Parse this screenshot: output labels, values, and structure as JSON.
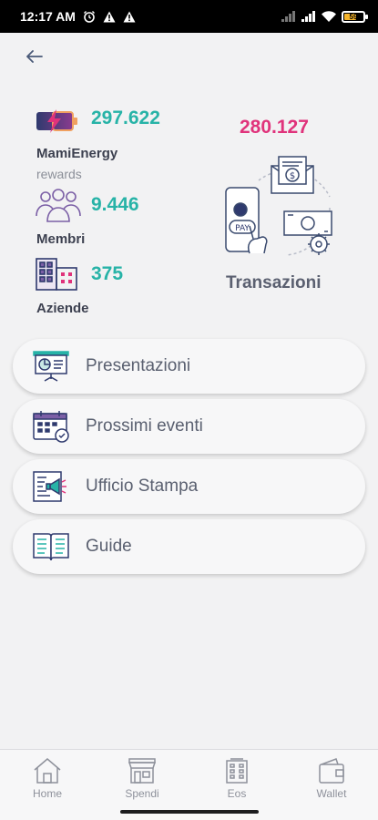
{
  "status_bar": {
    "time": "12:17 AM",
    "battery": "59"
  },
  "stats": {
    "energy": {
      "value": "297.622",
      "label": "MamiEnergy",
      "sublabel": "rewards",
      "icon": "battery-bolt-icon"
    },
    "members": {
      "value": "9.446",
      "label": "Membri",
      "icon": "people-icon"
    },
    "companies": {
      "value": "375",
      "label": "Aziende",
      "icon": "building-icon"
    },
    "transactions": {
      "value": "280.127",
      "label": "Transazioni",
      "icon": "payment-transactions-illustration"
    }
  },
  "menu": [
    {
      "label": "Presentazioni",
      "icon": "presentation-board-icon"
    },
    {
      "label": "Prossimi eventi",
      "icon": "calendar-check-icon"
    },
    {
      "label": "Ufficio Stampa",
      "icon": "megaphone-document-icon"
    },
    {
      "label": "Guide",
      "icon": "open-book-icon"
    }
  ],
  "bottom_nav": [
    {
      "label": "Home",
      "icon": "home-icon"
    },
    {
      "label": "Spendi",
      "icon": "shop-icon"
    },
    {
      "label": "Eos",
      "icon": "eos-building-icon"
    },
    {
      "label": "Wallet",
      "icon": "wallet-icon"
    }
  ],
  "colors": {
    "accent_teal": "#27b3a7",
    "accent_pink": "#e0337b",
    "icon_navy": "#2f3a6e"
  }
}
